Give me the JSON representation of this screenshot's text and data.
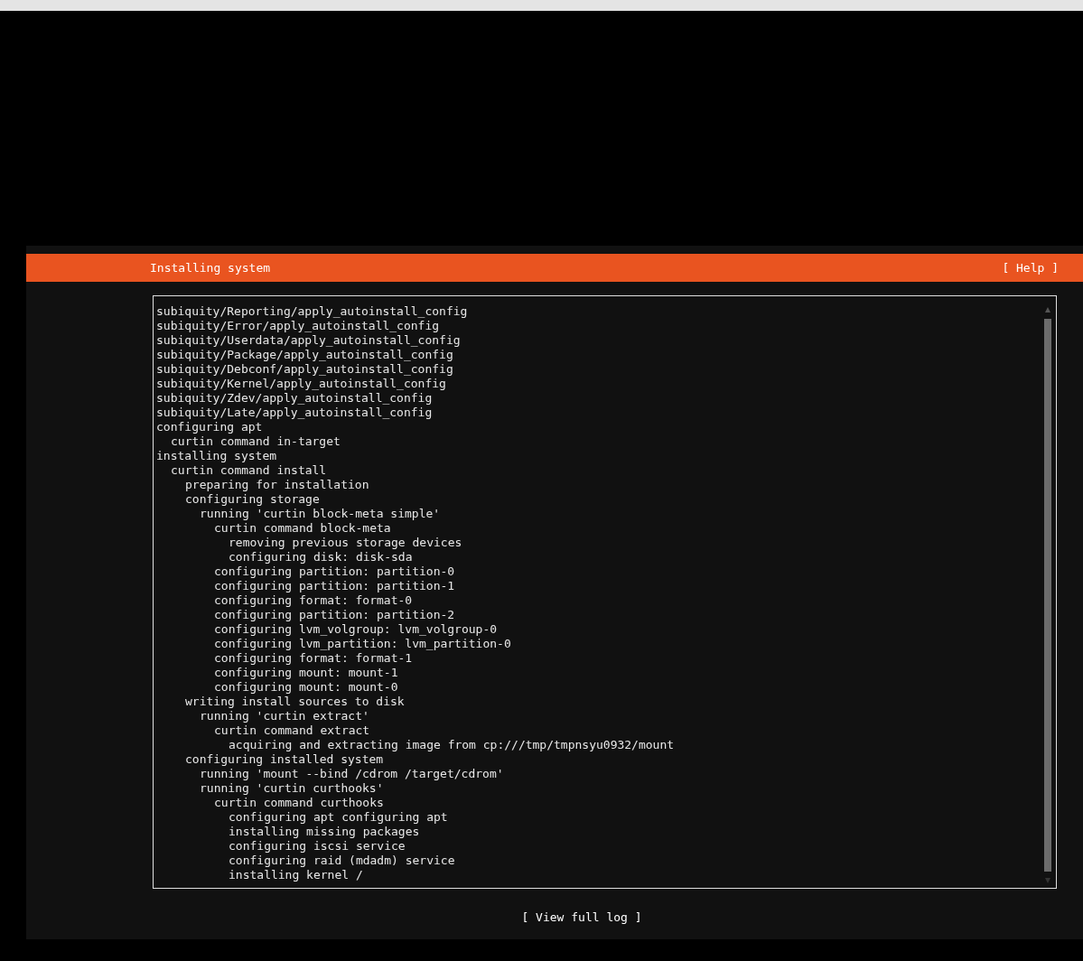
{
  "header": {
    "title": "Installing system",
    "help_button": "[ Help ]"
  },
  "log": [
    {
      "text": "subiquity/Reporting/apply_autoinstall_config"
    },
    {
      "text": "subiquity/Error/apply_autoinstall_config"
    },
    {
      "text": "subiquity/Userdata/apply_autoinstall_config"
    },
    {
      "text": "subiquity/Package/apply_autoinstall_config"
    },
    {
      "text": "subiquity/Debconf/apply_autoinstall_config"
    },
    {
      "text": "subiquity/Kernel/apply_autoinstall_config"
    },
    {
      "text": "subiquity/Zdev/apply_autoinstall_config"
    },
    {
      "text": "subiquity/Late/apply_autoinstall_config"
    },
    {
      "text": "configuring apt",
      "children": [
        {
          "text": "curtin command in-target"
        }
      ]
    },
    {
      "text": "installing system",
      "children": [
        {
          "text": "curtin command install",
          "children": [
            {
              "text": "preparing for installation"
            },
            {
              "text": "configuring storage",
              "children": [
                {
                  "text": "running 'curtin block-meta simple'",
                  "children": [
                    {
                      "text": "curtin command block-meta",
                      "children": [
                        {
                          "text": "removing previous storage devices"
                        },
                        {
                          "text": "configuring disk: disk-sda"
                        }
                      ]
                    },
                    {
                      "text": "configuring partition: partition-0"
                    },
                    {
                      "text": "configuring partition: partition-1"
                    },
                    {
                      "text": "configuring format: format-0"
                    },
                    {
                      "text": "configuring partition: partition-2"
                    },
                    {
                      "text": "configuring lvm_volgroup: lvm_volgroup-0"
                    },
                    {
                      "text": "configuring lvm_partition: lvm_partition-0"
                    },
                    {
                      "text": "configuring format: format-1"
                    },
                    {
                      "text": "configuring mount: mount-1"
                    },
                    {
                      "text": "configuring mount: mount-0"
                    }
                  ]
                }
              ]
            },
            {
              "text": "writing install sources to disk",
              "children": [
                {
                  "text": "running 'curtin extract'",
                  "children": [
                    {
                      "text": "curtin command extract",
                      "children": [
                        {
                          "text": "acquiring and extracting image from cp:///tmp/tmpnsyu0932/mount"
                        }
                      ]
                    }
                  ]
                }
              ]
            },
            {
              "text": "configuring installed system",
              "children": [
                {
                  "text": "running 'mount --bind /cdrom /target/cdrom'"
                },
                {
                  "text": "running 'curtin curthooks'",
                  "children": [
                    {
                      "text": "curtin command curthooks",
                      "children": [
                        {
                          "text": "configuring apt configuring apt"
                        },
                        {
                          "text": "installing missing packages"
                        },
                        {
                          "text": "configuring iscsi service"
                        },
                        {
                          "text": "configuring raid (mdadm) service"
                        },
                        {
                          "text": "installing kernel /"
                        }
                      ]
                    }
                  ]
                }
              ]
            }
          ]
        }
      ]
    }
  ],
  "footer_button": "[ View full log ]"
}
